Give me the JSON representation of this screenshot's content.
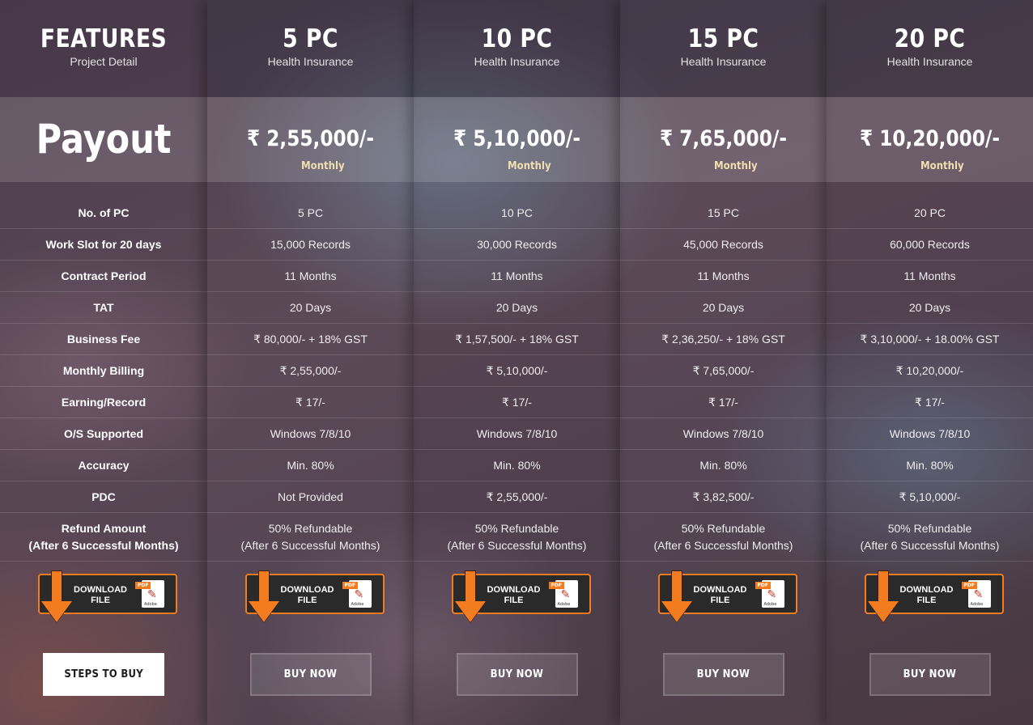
{
  "features": {
    "title": "FEATURES",
    "subtitle": "Project Detail",
    "payout_label": "Payout",
    "rows": [
      "No. of PC",
      "Work Slot for 20 days",
      "Contract Period",
      "TAT",
      "Business Fee",
      "Monthly Billing",
      "Earning/Record",
      "O/S Supported",
      "Accuracy",
      "PDC"
    ],
    "refund_line1": "Refund Amount",
    "refund_line2": "(After 6 Successful Months)",
    "download": {
      "line1": "DOWNLOAD",
      "line2": "FILE",
      "tag": "PDF",
      "brand": "Adobe"
    },
    "button": "STEPS TO BUY"
  },
  "plans": [
    {
      "title": "5 PC",
      "subtitle": "Health Insurance",
      "price": "₹   2,55,000/-",
      "period": "Monthly",
      "rows": [
        "5 PC",
        "15,000 Records",
        "11 Months",
        "20 Days",
        "₹ 80,000/- + 18% GST",
        "₹ 2,55,000/-",
        "₹ 17/-",
        "Windows 7/8/10",
        "Min. 80%",
        "Not Provided"
      ],
      "refund_line1": "50% Refundable",
      "refund_line2": "(After 6 Successful Months)",
      "button": "BUY NOW"
    },
    {
      "title": "10 PC",
      "subtitle": "Health Insurance",
      "price": "₹ 5,10,000/-",
      "period": "Monthly",
      "rows": [
        "10 PC",
        "30,000 Records",
        "11 Months",
        "20 Days",
        "₹ 1,57,500/- + 18% GST",
        "₹ 5,10,000/-",
        "₹ 17/-",
        "Windows 7/8/10",
        "Min. 80%",
        "₹ 2,55,000/-"
      ],
      "refund_line1": "50% Refundable",
      "refund_line2": "(After 6 Successful Months)",
      "button": "BUY NOW"
    },
    {
      "title": "15 PC",
      "subtitle": "Health Insurance",
      "price": "₹ 7,65,000/-",
      "period": "Monthly",
      "rows": [
        "15 PC",
        "45,000 Records",
        "11 Months",
        "20 Days",
        "₹ 2,36,250/- + 18% GST",
        "₹ 7,65,000/-",
        "₹ 17/-",
        "Windows 7/8/10",
        "Min. 80%",
        "₹ 3,82,500/-"
      ],
      "refund_line1": "50% Refundable",
      "refund_line2": "(After 6 Successful Months)",
      "button": "BUY NOW"
    },
    {
      "title": "20 PC",
      "subtitle": "Health Insurance",
      "price": "₹ 10,20,000/-",
      "period": "Monthly",
      "rows": [
        "20 PC",
        "60,000 Records",
        "11 Months",
        "20 Days",
        "₹ 3,10,000/- + 18.00% GST",
        "₹ 10,20,000/-",
        "₹ 17/-",
        "Windows 7/8/10",
        "Min. 80%",
        "₹ 5,10,000/-"
      ],
      "refund_line1": "50% Refundable",
      "refund_line2": "(After 6 Successful Months)",
      "button": "BUY NOW"
    }
  ],
  "colors": {
    "accent": "#f47c20",
    "period": "#f2dfb0"
  }
}
